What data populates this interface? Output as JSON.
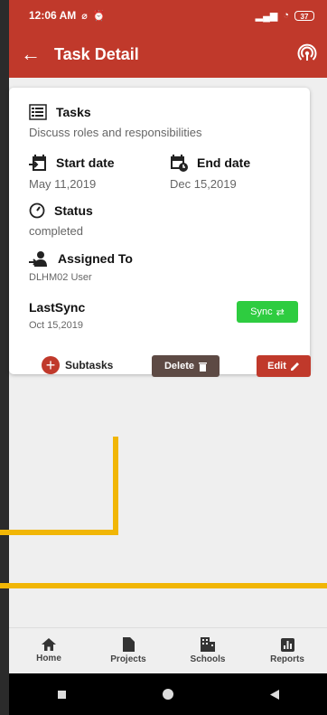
{
  "status_bar": {
    "time": "12:06 AM",
    "battery": "37"
  },
  "app_bar": {
    "title": "Task Detail"
  },
  "card": {
    "tasks": {
      "label": "Tasks",
      "value": "Discuss roles and responsibilities"
    },
    "start_date": {
      "label": "Start date",
      "value": "May 11,2019"
    },
    "end_date": {
      "label": "End date",
      "value": "Dec 15,2019"
    },
    "status": {
      "label": "Status",
      "value": "completed"
    },
    "assigned_to": {
      "label": "Assigned To",
      "value": "DLHM02 User"
    },
    "last_sync": {
      "label": "LastSync",
      "value": "Oct 15,2019"
    },
    "sync_label": "Sync",
    "subtasks_label": "Subtasks",
    "delete_label": "Delete",
    "edit_label": "Edit"
  },
  "bottom_nav": {
    "home": "Home",
    "projects": "Projects",
    "schools": "Schools",
    "reports": "Reports"
  },
  "colors": {
    "primary": "#c0392b",
    "sync_green": "#2ecc40",
    "delete_brown": "#5d4a44",
    "highlight_yellow": "#f1b606"
  }
}
